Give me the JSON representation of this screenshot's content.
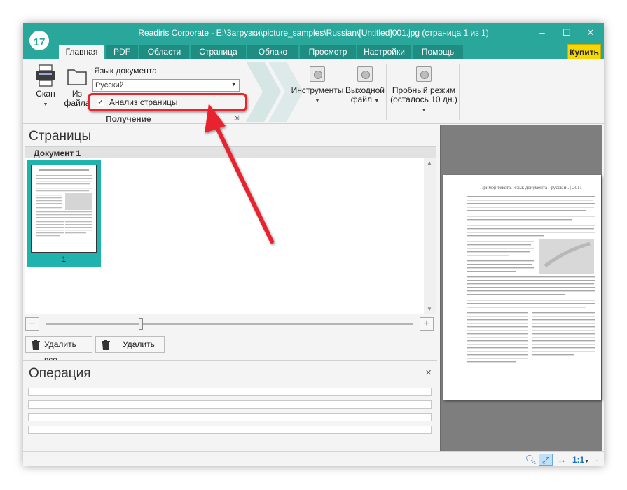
{
  "window": {
    "title": "Readiris Corporate - E:\\Загрузки\\picture_samples\\Russian\\[Untitled]001.jpg (страница 1 из 1)",
    "logo_text": "17",
    "minimize": "–",
    "maximize": "☐",
    "close": "✕"
  },
  "tabs": [
    "Главная",
    "PDF",
    "Области",
    "Страница",
    "Облако",
    "Просмотр",
    "Настройки",
    "Помощь"
  ],
  "buy_label": "Купить",
  "ribbon": {
    "scan_label": "Скан",
    "from_file_label_1": "Из",
    "from_file_label_2": "файла",
    "language_label": "Язык документа",
    "language_value": "Русский",
    "page_analysis_label": "Анализ страницы",
    "page_analysis_checked": true,
    "acquisition_group": "Получение",
    "tools_label": "Инструменты",
    "output_label_1": "Выходной",
    "output_label_2": "файл",
    "trial_label_1": "Пробный режим",
    "trial_label_2": "(осталось 10 дн.)"
  },
  "pages_panel": {
    "title": "Страницы",
    "document_label": "Документ 1",
    "page_number": "1",
    "delete_all_label": "Удалить все",
    "delete_label": "Удалить"
  },
  "operation_panel": {
    "title": "Операция",
    "close": "×"
  },
  "preview": {
    "page_title": "Пример текста. Язык документа –русский.",
    "page_year": "2011"
  },
  "statusbar": {
    "zoom_ratio": "1:1"
  },
  "colors": {
    "accent": "#2aa79b",
    "buy": "#f6d800",
    "highlight": "#e8242e"
  }
}
